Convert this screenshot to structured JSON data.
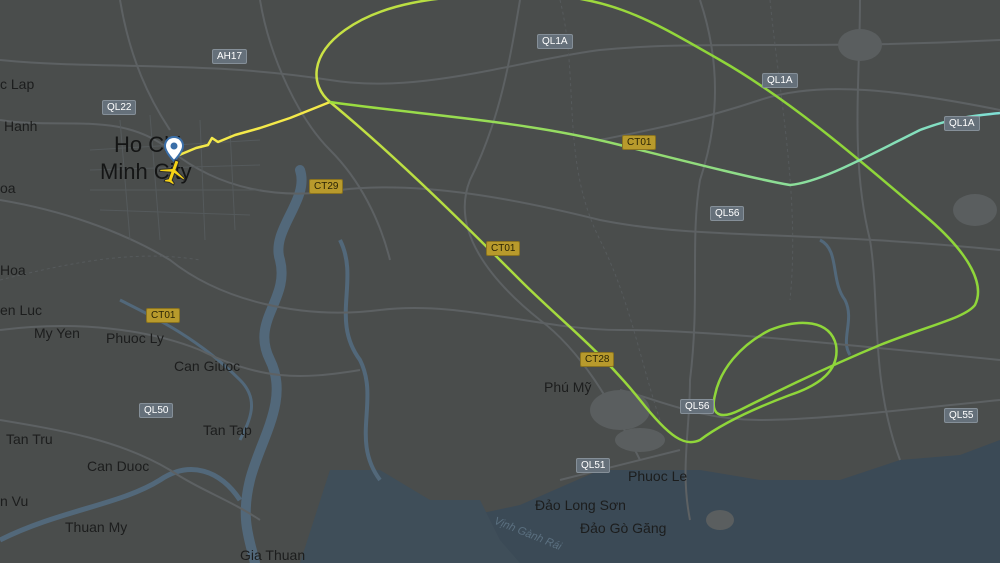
{
  "colors": {
    "land": "#4a4d4c",
    "water": "#3b4a56",
    "river": "#52687a",
    "road": "#5d6163",
    "track_start": "#f4e94a",
    "track_mid": "#8fd63a",
    "track_end": "#7fe0d6",
    "aircraft": "#f5d216"
  },
  "cities": {
    "hcm_line1": "Ho Chi",
    "hcm_line2": "Minh City"
  },
  "places": [
    "c Lap",
    "Hanh",
    "oa",
    "Hoa",
    "en Luc",
    "My Yen",
    "Phuoc Ly",
    "Can Giuoc",
    "Tan Tap",
    "Tan Tru",
    "Can Duoc",
    "n Vu",
    "Thuan My",
    "Gia Thuan",
    "Phú Mỹ",
    "Phuoc Le",
    "Đảo Long Sơn",
    "Đảo Gò Găng"
  ],
  "marine": {
    "vinh_ganh_rai": "Vịnh Gành Rái"
  },
  "roads": {
    "ah17": "AH17",
    "ql1a_a": "QL1A",
    "ql1a_b": "QL1A",
    "ql1a_c": "QL1A",
    "ql22": "QL22",
    "ct01_a": "CT01",
    "ct01_b": "CT01",
    "ct01_c": "CT01",
    "ct29": "CT29",
    "ct28": "CT28",
    "ql56_a": "QL56",
    "ql56_b": "QL56",
    "ql55": "QL55",
    "ql50": "QL50",
    "ql51": "QL51"
  },
  "icons": {
    "airport_pin": "location-pin-icon",
    "aircraft": "airplane-icon"
  }
}
